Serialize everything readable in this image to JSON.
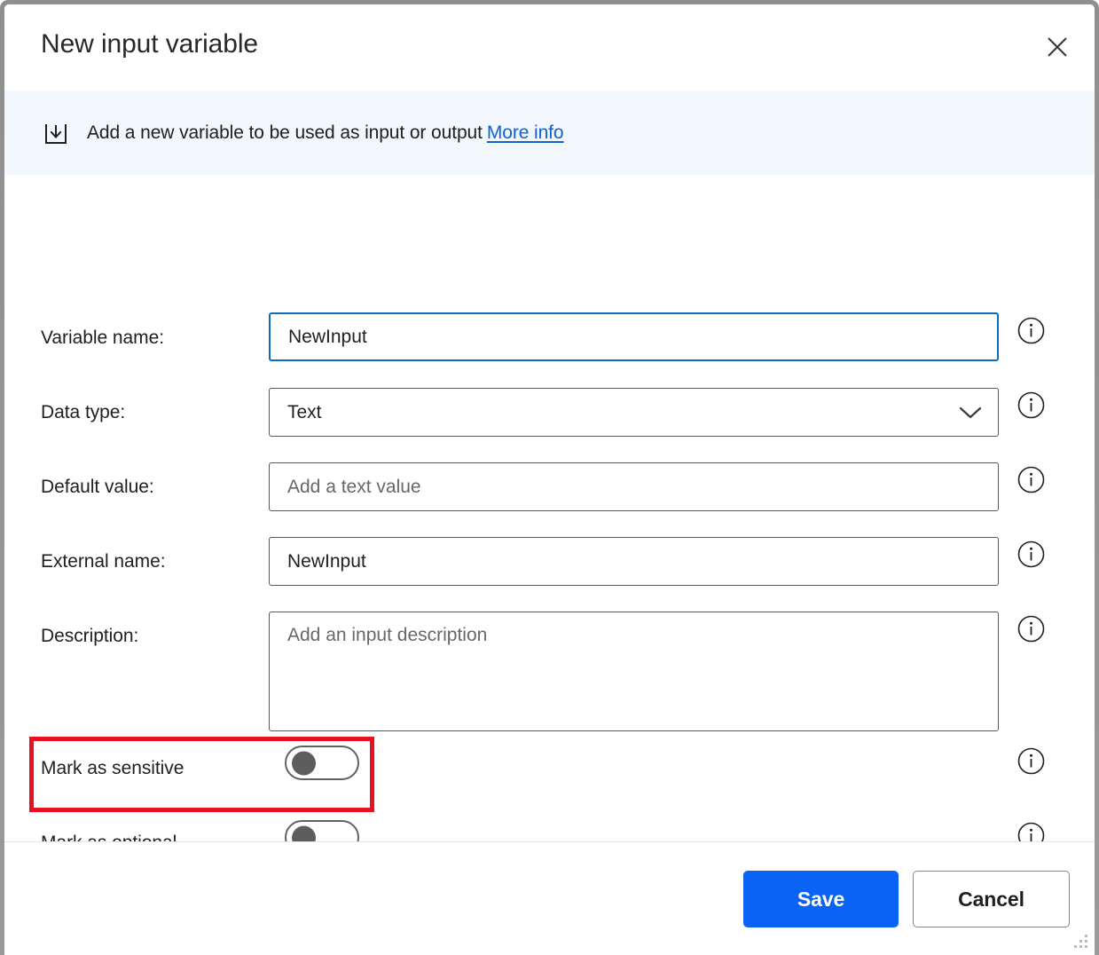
{
  "window": {
    "title": "New input variable",
    "close_icon": "close-icon",
    "resize_grip": "resize-grip"
  },
  "banner": {
    "icon": "input-download-icon",
    "text": "Add a new variable to be used as input or output",
    "link_label": "More info",
    "background_color": "#f2f6fd",
    "link_color": "#1062d5"
  },
  "form": {
    "info_icon_label": "info-icon",
    "fields": [
      {
        "label": "Variable name:",
        "value": "NewInput",
        "placeholder": "",
        "type": "text",
        "focused": true
      },
      {
        "label": "Data type:",
        "value": "Text",
        "placeholder": "",
        "type": "dropdown",
        "focused": false,
        "chevron_icon": "chevron-down-icon"
      },
      {
        "label": "Default value:",
        "value": "",
        "placeholder": "Add a text value",
        "type": "text",
        "focused": false
      },
      {
        "label": "External name:",
        "value": "NewInput",
        "placeholder": "",
        "type": "text",
        "focused": false
      },
      {
        "label": "Description:",
        "value": "",
        "placeholder": "Add an input description",
        "type": "textarea",
        "focused": false
      }
    ],
    "toggles": [
      {
        "label": "Mark as sensitive",
        "state": "off",
        "highlighted": false
      },
      {
        "label": "Mark as optional",
        "state": "off",
        "highlighted": true
      }
    ],
    "highlight_color": "#e81123"
  },
  "footer": {
    "save_label": "Save",
    "cancel_label": "Cancel",
    "save_color": "#0b63f6"
  }
}
